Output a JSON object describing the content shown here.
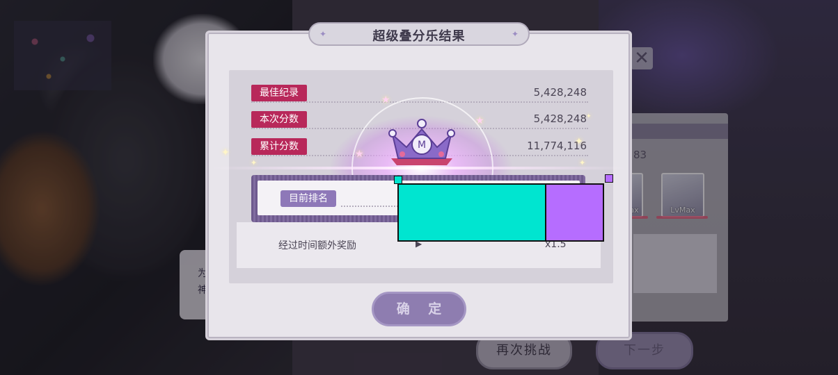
{
  "dialog": {
    "title": "超级叠分乐结果",
    "confirm_label": "确 定"
  },
  "scores": [
    {
      "label": "最佳纪录",
      "value": "5,428,248"
    },
    {
      "label": "本次分数",
      "value": "5,428,248"
    },
    {
      "label": "累计分数",
      "value": "11,774,116"
    }
  ],
  "rank": {
    "label": "目前排名"
  },
  "bonus": {
    "label": "经过时间额外奖励",
    "value": "x1.5"
  },
  "background": {
    "retry_label": "再次挑战",
    "next_label": "下一步",
    "side_text": "83",
    "card1_label": "ax",
    "card2_label": "LvMax",
    "close_glyph": "✕",
    "speech_text": "为\n神"
  },
  "overlay": {
    "teal_color": "#00e5d0",
    "violet_color": "#b66dff"
  },
  "icons": {
    "crown": "crown-icon",
    "sparkle": "sparkle-icon",
    "close": "close-icon"
  }
}
